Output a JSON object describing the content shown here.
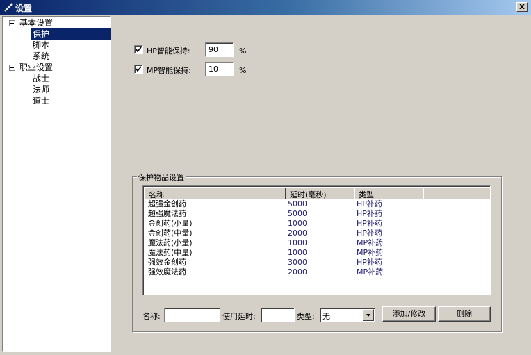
{
  "window": {
    "title": "设置",
    "close": "x"
  },
  "tree": {
    "groups": [
      {
        "label": "基本设置",
        "items": [
          "保护",
          "脚本",
          "系统"
        ]
      },
      {
        "label": "职业设置",
        "items": [
          "战士",
          "法师",
          "道士"
        ]
      }
    ],
    "selected": "保护"
  },
  "protection": {
    "hp_label": "HP智能保持:",
    "hp_value": "90",
    "hp_unit": "%",
    "hp_checked": true,
    "mp_label": "MP智能保持:",
    "mp_value": "10",
    "mp_unit": "%",
    "mp_checked": true
  },
  "items_group": {
    "title": "保护物品设置",
    "columns": [
      "名称",
      "延时(毫秒)",
      "类型",
      ""
    ],
    "rows": [
      [
        "超强金创药",
        "5000",
        "HP补药"
      ],
      [
        "超强魔法药",
        "5000",
        "HP补药"
      ],
      [
        "金创药(小量)",
        "1000",
        "HP补药"
      ],
      [
        "金创药(中量)",
        "2000",
        "HP补药"
      ],
      [
        "魔法药(小量)",
        "1000",
        "MP补药"
      ],
      [
        "魔法药(中量)",
        "1000",
        "MP补药"
      ],
      [
        "强效金创药",
        "3000",
        "HP补药"
      ],
      [
        "强效魔法药",
        "2000",
        "MP补药"
      ]
    ],
    "name_label": "名称:",
    "name_value": "",
    "delay_label": "使用延时:",
    "delay_value": "",
    "type_label": "类型:",
    "type_value": "无",
    "add_button": "添加/修改",
    "delete_button": "删除"
  }
}
